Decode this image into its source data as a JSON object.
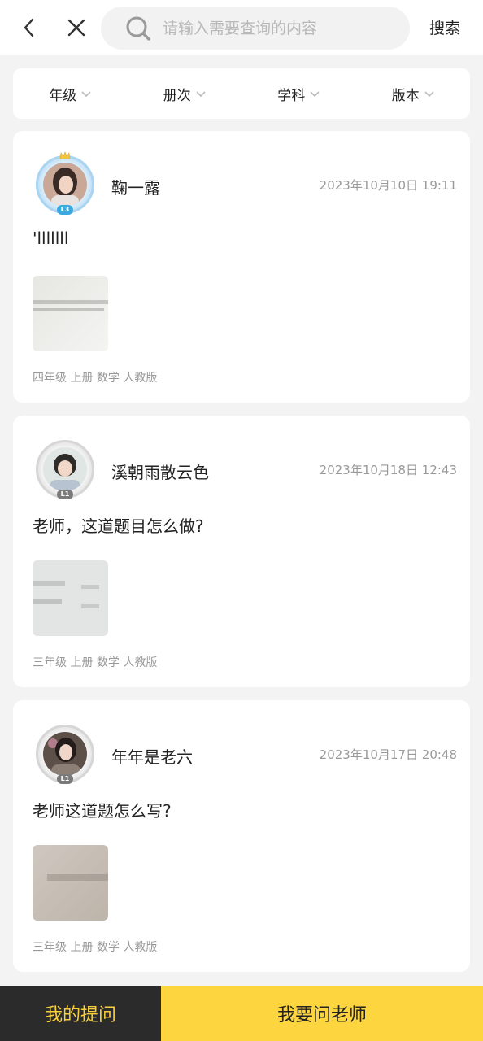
{
  "header": {
    "back_icon": "chevron-left-icon",
    "close_icon": "close-icon",
    "search_icon": "search-icon",
    "search_placeholder": "请输入需要查询的内容",
    "search_value": "",
    "search_button": "搜索"
  },
  "filters": [
    {
      "label": "年级",
      "icon": "chevron-down-icon"
    },
    {
      "label": "册次",
      "icon": "chevron-down-icon"
    },
    {
      "label": "学科",
      "icon": "chevron-down-icon"
    },
    {
      "label": "版本",
      "icon": "chevron-down-icon"
    }
  ],
  "posts": [
    {
      "username": "鞠一露",
      "level": "L3",
      "time": "2023年10月10日 19:11",
      "text": "'lllllll",
      "tags": "四年级 上册 数学 人教版",
      "ring_color": "#8fc6ee",
      "badge_color": "#3ba8e0"
    },
    {
      "username": "溪朝雨散云色",
      "level": "L1",
      "time": "2023年10月18日 12:43",
      "text": "老师，这道题目怎么做?",
      "tags": "三年级 上册 数学 人教版",
      "ring_color": "#cfcfcf",
      "badge_color": "#7a7a7a"
    },
    {
      "username": "年年是老六",
      "level": "L1",
      "time": "2023年10月17日 20:48",
      "text": "老师这道题怎么写?",
      "tags": "三年级 上册 数学 人教版",
      "ring_color": "#cfcfcf",
      "badge_color": "#7a7a7a"
    }
  ],
  "bottom": {
    "my_questions": "我的提问",
    "ask_teacher": "我要问老师"
  },
  "colors": {
    "accent_yellow": "#fcd53f",
    "dark_bar": "#2b2b2b",
    "muted_text": "#999999"
  }
}
